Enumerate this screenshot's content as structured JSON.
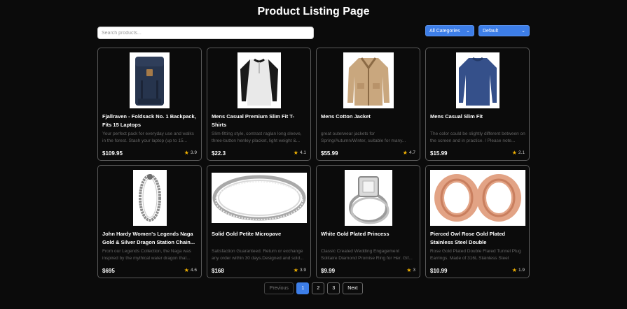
{
  "page": {
    "title": "Product Listing Page"
  },
  "search": {
    "placeholder": "Search products...",
    "value": ""
  },
  "filters": {
    "category": {
      "selected": "All Categories"
    },
    "sort": {
      "selected": "Default"
    }
  },
  "products": [
    {
      "title": "Fjallraven - Foldsack No. 1 Backpack, Fits 15 Laptops",
      "description": "Your perfect pack for everyday use and walks in the forest. Stash your laptop (up to 15...",
      "price": "$109.95",
      "rating": "3.9",
      "icon": "backpack-image"
    },
    {
      "title": "Mens Casual Premium Slim Fit T-Shirts",
      "description": "Slim-fitting style, contrast raglan long sleeve, three-button henley placket, light weight &...",
      "price": "$22.3",
      "rating": "4.1",
      "icon": "henley-shirt-image"
    },
    {
      "title": "Mens Cotton Jacket",
      "description": "great outerwear jackets for Spring/Autumn/Winter, suitable for many...",
      "price": "$55.99",
      "rating": "4.7",
      "icon": "cotton-jacket-image"
    },
    {
      "title": "Mens Casual Slim Fit",
      "description": "The color could be slightly different between on the screen and in practice. / Please note...",
      "price": "$15.99",
      "rating": "2.1",
      "icon": "long-sleeve-shirt-image"
    },
    {
      "title": "John Hardy Women's Legends Naga Gold & Silver Dragon Station Chain...",
      "description": "From our Legends Collection, the Naga was inspired by the mythical water dragon that...",
      "price": "$695",
      "rating": "4.6",
      "icon": "bracelet-image"
    },
    {
      "title": "Solid Gold Petite Micropave",
      "description": "Satisfaction Guaranteed. Return or exchange any order within 30 days.Designed and sold...",
      "price": "$168",
      "rating": "3.9",
      "icon": "silver-ring-image"
    },
    {
      "title": "White Gold Plated Princess",
      "description": "Classic Created Wedding Engagement Solitaire Diamond Promise Ring for Her. Gif...",
      "price": "$9.99",
      "rating": "3",
      "icon": "engagement-ring-image"
    },
    {
      "title": "Pierced Owl Rose Gold Plated Stainless Steel Double",
      "description": "Rose Gold Plated Double Flared Tunnel Plug Earrings. Made of 316L Stainless Steel",
      "price": "$10.99",
      "rating": "1.9",
      "icon": "rose-gold-plugs-image"
    }
  ],
  "pagination": {
    "previous": "Previous",
    "pages": [
      "1",
      "2",
      "3"
    ],
    "current": "1",
    "next": "Next"
  },
  "colors": {
    "accent": "#3d7ee8",
    "star": "#f5b400",
    "background": "#0b0b0b"
  }
}
